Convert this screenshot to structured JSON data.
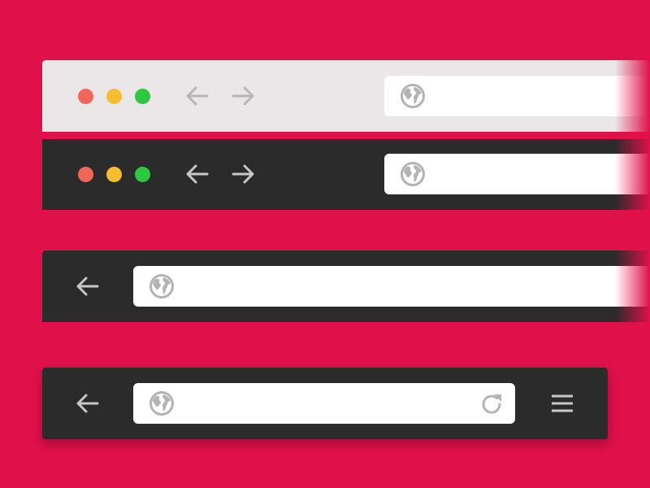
{
  "colors": {
    "background": "#e0104a",
    "light_bar": "#ebe6e7",
    "dark_bar": "#2b2b2b",
    "url_field": "#ffffff",
    "icon_light_bar": "#b9b4b6",
    "icon_dark_bar": "#c8c8c8",
    "icon_in_field": "#b3b3b3",
    "traffic_red": "#f26658",
    "traffic_yellow": "#f6be2e",
    "traffic_green": "#2bc840"
  },
  "toolbars": [
    {
      "theme": "light",
      "variant": "macOS",
      "controls": [
        "close",
        "minimize",
        "maximize"
      ],
      "buttons": [
        "back-arrow-icon",
        "forward-arrow-icon"
      ],
      "address_bar": {
        "icon": "globe-icon",
        "value": ""
      }
    },
    {
      "theme": "dark",
      "variant": "macOS",
      "controls": [
        "close",
        "minimize",
        "maximize"
      ],
      "buttons": [
        "back-arrow-icon",
        "forward-arrow-icon"
      ],
      "address_bar": {
        "icon": "globe-icon",
        "value": ""
      }
    },
    {
      "theme": "dark",
      "variant": "minimal",
      "buttons": [
        "back-arrow-icon"
      ],
      "address_bar": {
        "icon": "globe-icon",
        "value": ""
      }
    },
    {
      "theme": "dark",
      "variant": "mobile",
      "buttons": [
        "back-arrow-icon",
        "menu-icon"
      ],
      "address_bar": {
        "icon": "globe-icon",
        "action_icon": "reload-icon",
        "value": ""
      }
    }
  ]
}
